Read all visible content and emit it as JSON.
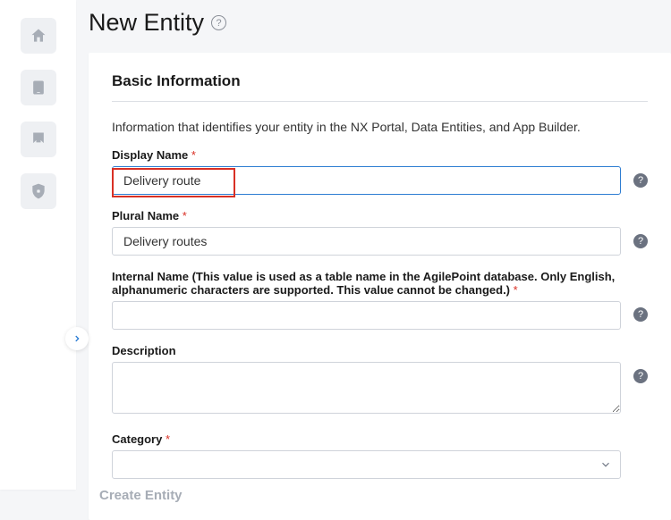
{
  "page": {
    "title": "New Entity",
    "create_button": "Create Entity"
  },
  "section": {
    "title": "Basic Information",
    "description": "Information that identifies your entity in the NX Portal, Data Entities, and App Builder."
  },
  "fields": {
    "display_name": {
      "label": "Display Name",
      "value": "Delivery route"
    },
    "plural_name": {
      "label": "Plural Name",
      "value": "Delivery routes"
    },
    "internal_name": {
      "label": "Internal Name (This value is used as a table name in the AgilePoint database. Only English, alphanumeric characters are supported. This value cannot be changed.)",
      "value": ""
    },
    "description": {
      "label": "Description",
      "value": ""
    },
    "category": {
      "label": "Category",
      "value": ""
    }
  },
  "glyphs": {
    "required": " *",
    "help": "?"
  }
}
